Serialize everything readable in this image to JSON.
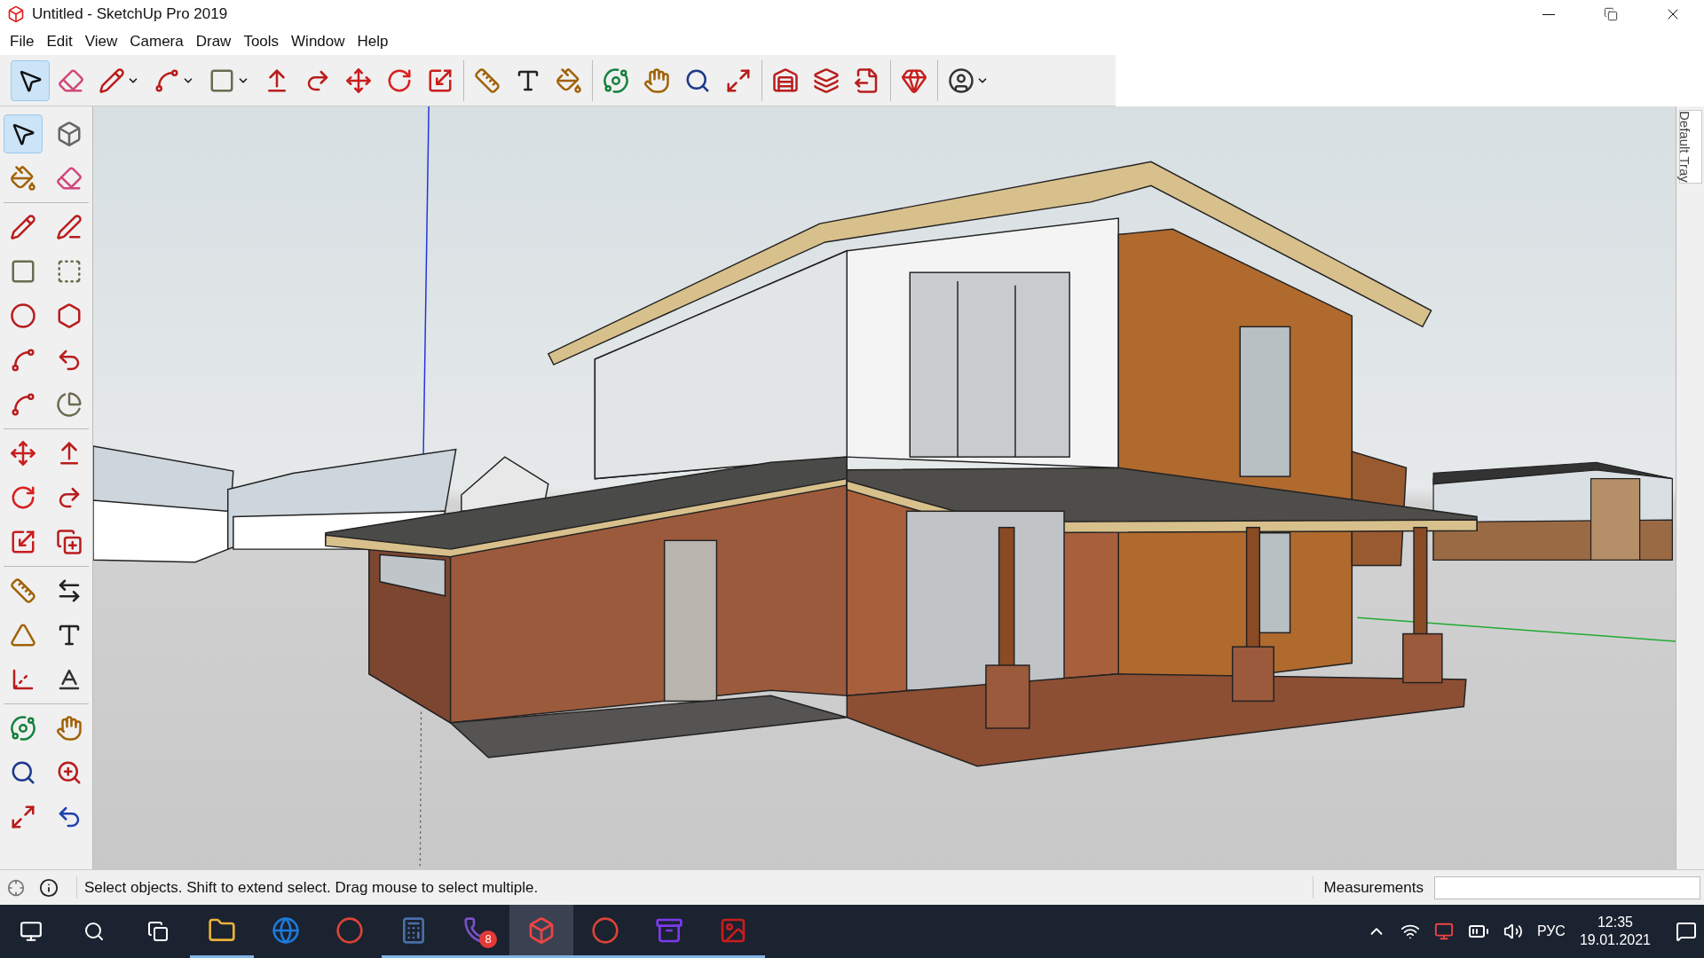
{
  "window": {
    "title": "Untitled - SketchUp Pro 2019"
  },
  "menu": [
    "File",
    "Edit",
    "View",
    "Camera",
    "Draw",
    "Tools",
    "Window",
    "Help"
  ],
  "main_toolbar": [
    [
      {
        "kind": "select",
        "selected": true
      },
      {
        "kind": "eraser",
        "selected": false
      },
      {
        "kind": "pencil",
        "selected": false
      },
      {
        "kind": "arc",
        "selected": false
      },
      {
        "kind": "rectangle",
        "selected": false
      },
      {
        "kind": "pushpull",
        "selected": false
      },
      {
        "kind": "followme",
        "selected": false
      },
      {
        "kind": "move",
        "selected": false
      },
      {
        "kind": "rotate",
        "selected": false
      },
      {
        "kind": "scale",
        "selected": false
      }
    ],
    [
      {
        "kind": "tape",
        "selected": false
      },
      {
        "kind": "text",
        "selected": false
      },
      {
        "kind": "paint",
        "selected": false
      }
    ],
    [
      {
        "kind": "orbit",
        "selected": false
      },
      {
        "kind": "pan",
        "selected": false
      },
      {
        "kind": "zoom",
        "selected": false
      },
      {
        "kind": "extents",
        "selected": false
      }
    ],
    [
      {
        "kind": "warehouse",
        "selected": false
      },
      {
        "kind": "share",
        "selected": false
      },
      {
        "kind": "export",
        "selected": false
      }
    ],
    [
      {
        "kind": "ruby",
        "selected": false
      }
    ],
    [
      {
        "kind": "account",
        "selected": false
      }
    ]
  ],
  "left_toolbar": [
    [
      {
        "kind": "select",
        "selected": true
      },
      {
        "kind": "component",
        "selected": false
      },
      {
        "kind": "paint",
        "selected": false
      },
      {
        "kind": "eraser",
        "selected": false
      }
    ],
    [
      {
        "kind": "pencil",
        "selected": false
      },
      {
        "kind": "freehand",
        "selected": false
      },
      {
        "kind": "rectangle",
        "selected": false
      },
      {
        "kind": "rotrect",
        "selected": false
      },
      {
        "kind": "circle",
        "selected": false
      },
      {
        "kind": "polygon",
        "selected": false
      },
      {
        "kind": "arc",
        "selected": false
      },
      {
        "kind": "arc2",
        "selected": false
      },
      {
        "kind": "arc3",
        "selected": false
      },
      {
        "kind": "pie",
        "selected": false
      }
    ],
    [
      {
        "kind": "move",
        "selected": false
      },
      {
        "kind": "pushpull",
        "selected": false
      },
      {
        "kind": "rotate",
        "selected": false
      },
      {
        "kind": "followme",
        "selected": false
      },
      {
        "kind": "scale",
        "selected": false
      },
      {
        "kind": "offset",
        "selected": false
      }
    ],
    [
      {
        "kind": "tape",
        "selected": false
      },
      {
        "kind": "dimension",
        "selected": false
      },
      {
        "kind": "protractor",
        "selected": false
      },
      {
        "kind": "text",
        "selected": false
      },
      {
        "kind": "axes",
        "selected": false
      },
      {
        "kind": "text3d",
        "selected": false
      }
    ],
    [
      {
        "kind": "orbit",
        "selected": false
      },
      {
        "kind": "pan",
        "selected": false
      },
      {
        "kind": "zoom",
        "selected": false
      },
      {
        "kind": "zoomwindow",
        "selected": false
      },
      {
        "kind": "extents",
        "selected": false
      },
      {
        "kind": "previous",
        "selected": false
      }
    ]
  ],
  "tray": {
    "label": "Default Tray"
  },
  "status_bar": {
    "message": "Select objects. Shift to extend select. Drag mouse to select multiple.",
    "measurements_label": "Measurements"
  },
  "taskbar": {
    "apps": [
      {
        "kind": "folder",
        "running": true,
        "selected": false
      },
      {
        "kind": "edge",
        "running": false,
        "selected": false
      },
      {
        "kind": "chrome",
        "running": false,
        "selected": false
      },
      {
        "kind": "calculator",
        "running": true,
        "selected": false
      },
      {
        "kind": "viber",
        "running": true,
        "selected": false,
        "badge": "8"
      },
      {
        "kind": "sketchup",
        "running": true,
        "selected": true
      },
      {
        "kind": "chrome",
        "running": true,
        "selected": false
      },
      {
        "kind": "archive",
        "running": true,
        "selected": false
      },
      {
        "kind": "picture",
        "running": true,
        "selected": false
      }
    ],
    "language": "РУС",
    "time": "12:35",
    "date": "19.01.2021"
  }
}
